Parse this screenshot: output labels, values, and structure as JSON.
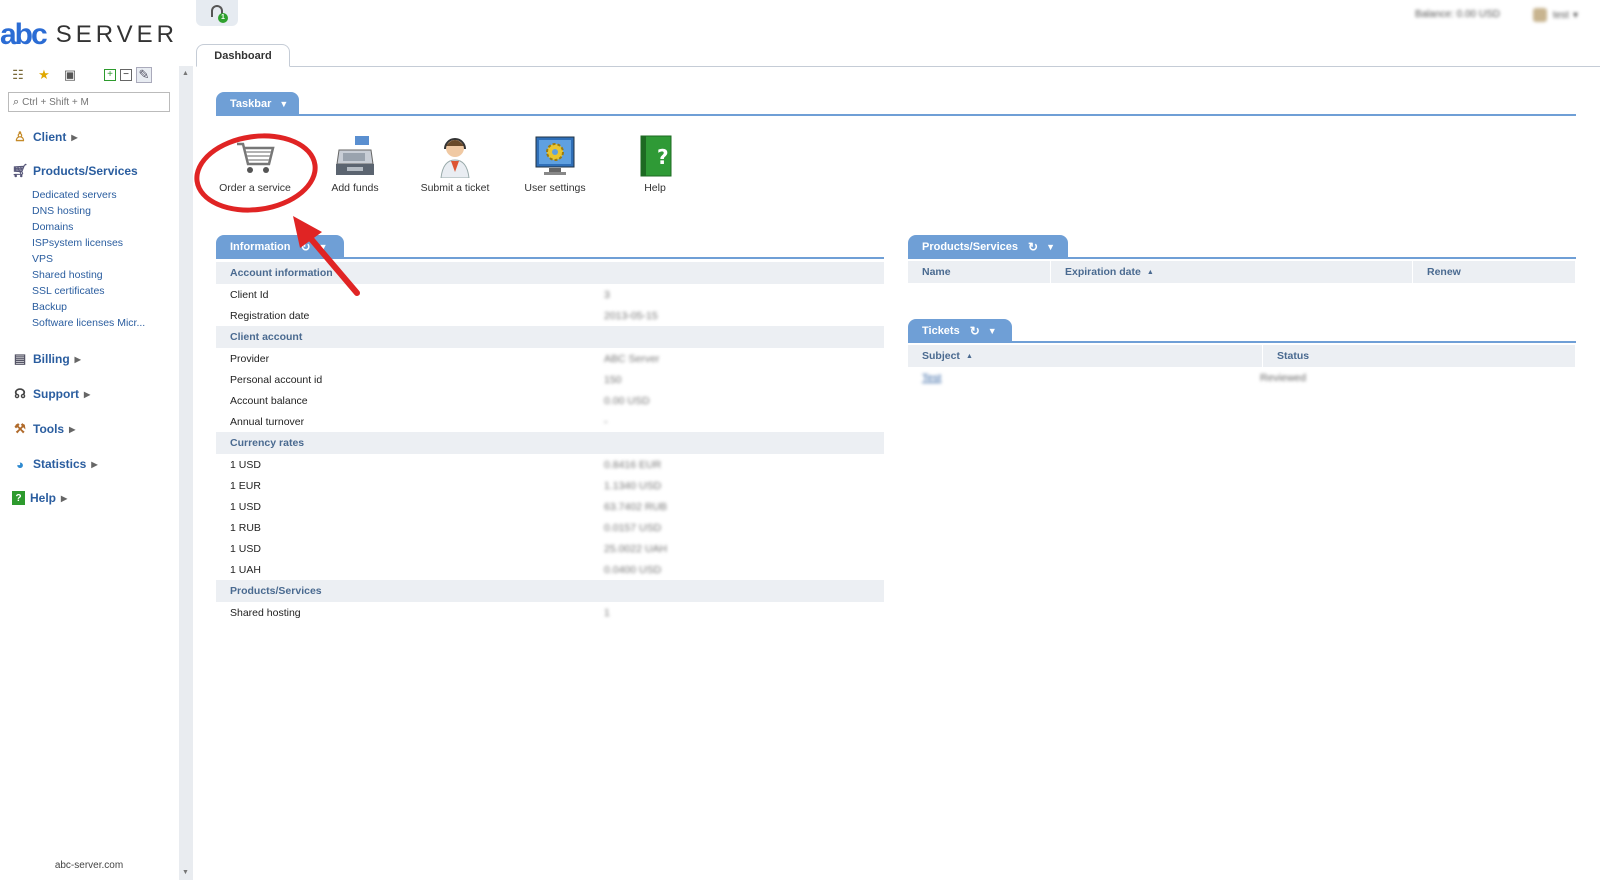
{
  "brand": {
    "mark": "abc",
    "name": "SERVER"
  },
  "sidebar": {
    "search_placeholder": "Ctrl + Shift + M",
    "sections": [
      {
        "label": "Client",
        "icon": "person-icon"
      },
      {
        "label": "Products/Services",
        "icon": "cart-icon"
      },
      {
        "label": "Billing",
        "icon": "register-icon"
      },
      {
        "label": "Support",
        "icon": "headset-icon"
      },
      {
        "label": "Tools",
        "icon": "tools-icon"
      },
      {
        "label": "Statistics",
        "icon": "chart-icon"
      },
      {
        "label": "Help",
        "icon": "help-book-icon"
      }
    ],
    "products_items": [
      "Dedicated servers",
      "DNS hosting",
      "Domains",
      "ISPsystem licenses",
      "VPS",
      "Shared hosting",
      "SSL certificates",
      "Backup",
      "Software licenses Micr..."
    ],
    "footer": "abc-server.com"
  },
  "topbar": {
    "badge": "1",
    "balance": "Balance: 0.00 USD",
    "user": "test"
  },
  "tabs": [
    "Dashboard"
  ],
  "taskbar": {
    "title": "Taskbar",
    "items": [
      {
        "label": "Order a service",
        "icon": "shopping-cart-icon"
      },
      {
        "label": "Add funds",
        "icon": "cash-register-icon"
      },
      {
        "label": "Submit a ticket",
        "icon": "support-agent-icon"
      },
      {
        "label": "User settings",
        "icon": "monitor-gear-icon"
      },
      {
        "label": "Help",
        "icon": "help-book-icon"
      }
    ]
  },
  "information": {
    "title": "Information",
    "rows": [
      {
        "type": "head",
        "label": "Account information"
      },
      {
        "label": "Client Id",
        "value": "3"
      },
      {
        "label": "Registration date",
        "value": "2013-05-15"
      },
      {
        "type": "head",
        "label": "Client account"
      },
      {
        "label": "Provider",
        "value": "ABC Server"
      },
      {
        "label": "Personal account id",
        "value": "150"
      },
      {
        "label": "Account balance",
        "value": "0.00 USD"
      },
      {
        "label": "Annual turnover",
        "value": "-"
      },
      {
        "type": "head",
        "label": "Currency rates"
      },
      {
        "label": "1 USD",
        "value": "0.8416 EUR"
      },
      {
        "label": "1 EUR",
        "value": "1.1340 USD"
      },
      {
        "label": "1 USD",
        "value": "63.7402 RUB"
      },
      {
        "label": "1 RUB",
        "value": "0.0157 USD"
      },
      {
        "label": "1 USD",
        "value": "25.0022 UAH"
      },
      {
        "label": "1 UAH",
        "value": "0.0400 USD"
      },
      {
        "type": "head",
        "label": "Products/Services"
      },
      {
        "label": "Shared hosting",
        "value": "1"
      }
    ]
  },
  "products_panel": {
    "title": "Products/Services",
    "columns": [
      "Name",
      "Expiration date",
      "Renew"
    ]
  },
  "tickets_panel": {
    "title": "Tickets",
    "columns": [
      "Subject",
      "Status"
    ],
    "rows": [
      {
        "subject": "Test",
        "status": "Reviewed"
      }
    ]
  },
  "colors": {
    "accent": "#6f9fd6",
    "link": "#2a5d9f",
    "annotation": "#e02424"
  }
}
